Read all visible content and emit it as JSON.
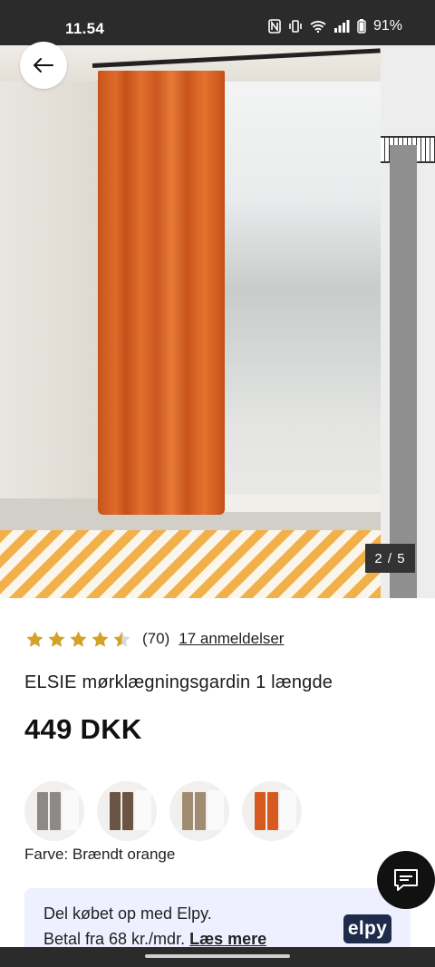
{
  "status_bar": {
    "time": "11.54",
    "battery": "91%"
  },
  "gallery": {
    "counter": "2 / 5"
  },
  "product": {
    "rating": 4.5,
    "rating_count": "(70)",
    "reviews_link": "17 anmeldelser",
    "title": "ELSIE mørklægningsgardin 1 længde",
    "price": "449 DKK",
    "color_label": "Farve: Brændt orange",
    "swatches": [
      {
        "name": "grey-swatch",
        "color": "#8c8a86"
      },
      {
        "name": "brown-swatch",
        "color": "#6b5444"
      },
      {
        "name": "beige-swatch",
        "color": "#a08c70"
      },
      {
        "name": "orange-swatch",
        "color": "#d65a20"
      }
    ]
  },
  "elpy": {
    "line1": "Del købet op med Elpy.",
    "line2_prefix": "Betal fra 68 kr./mdr.",
    "link": "Læs mere",
    "logo": "elpy"
  },
  "icons": {
    "back": "arrow-left-icon",
    "chat": "chat-icon"
  },
  "colors": {
    "star": "#d4a12a",
    "curtain": "#e06a2a",
    "banner_bg": "#eeefff",
    "elpy_logo": "#1e2b4a"
  }
}
